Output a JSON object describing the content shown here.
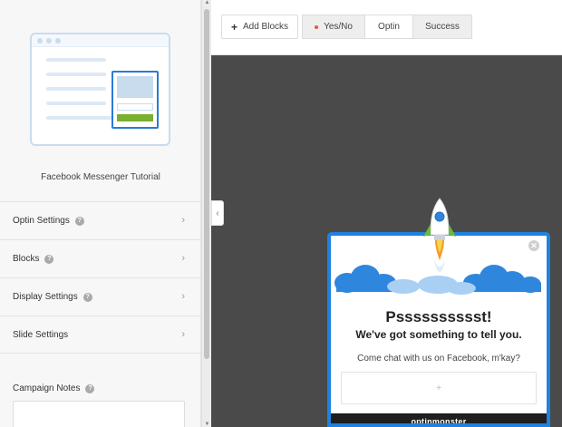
{
  "sidebar": {
    "template_title": "Facebook Messenger Tutorial",
    "items": [
      {
        "label": "Optin Settings"
      },
      {
        "label": "Blocks"
      },
      {
        "label": "Display Settings"
      },
      {
        "label": "Slide Settings"
      }
    ],
    "help_glyph": "?",
    "chevron_glyph": "›",
    "notes_label": "Campaign Notes"
  },
  "toolbar": {
    "add_blocks_icon": "+",
    "add_blocks_label": "Add Blocks",
    "tabs": [
      {
        "label": "Yes/No"
      },
      {
        "label": "Optin"
      },
      {
        "label": "Success"
      }
    ],
    "active_tab": "Optin"
  },
  "canvas": {
    "collapse_glyph": "‹"
  },
  "popup": {
    "close_glyph": "✕",
    "headline": "Psssssssssst!",
    "subheadline": "We've got something to tell you.",
    "text": "Come chat with us on Facebook, m'kay?",
    "input_glyph": "+",
    "footer_brand": "optinmonster"
  },
  "colors": {
    "accent_blue": "#1e82e0",
    "canvas_bg": "#4a4a4a",
    "status_dot": "#e45c3b",
    "cta_green": "#7ab02f"
  }
}
